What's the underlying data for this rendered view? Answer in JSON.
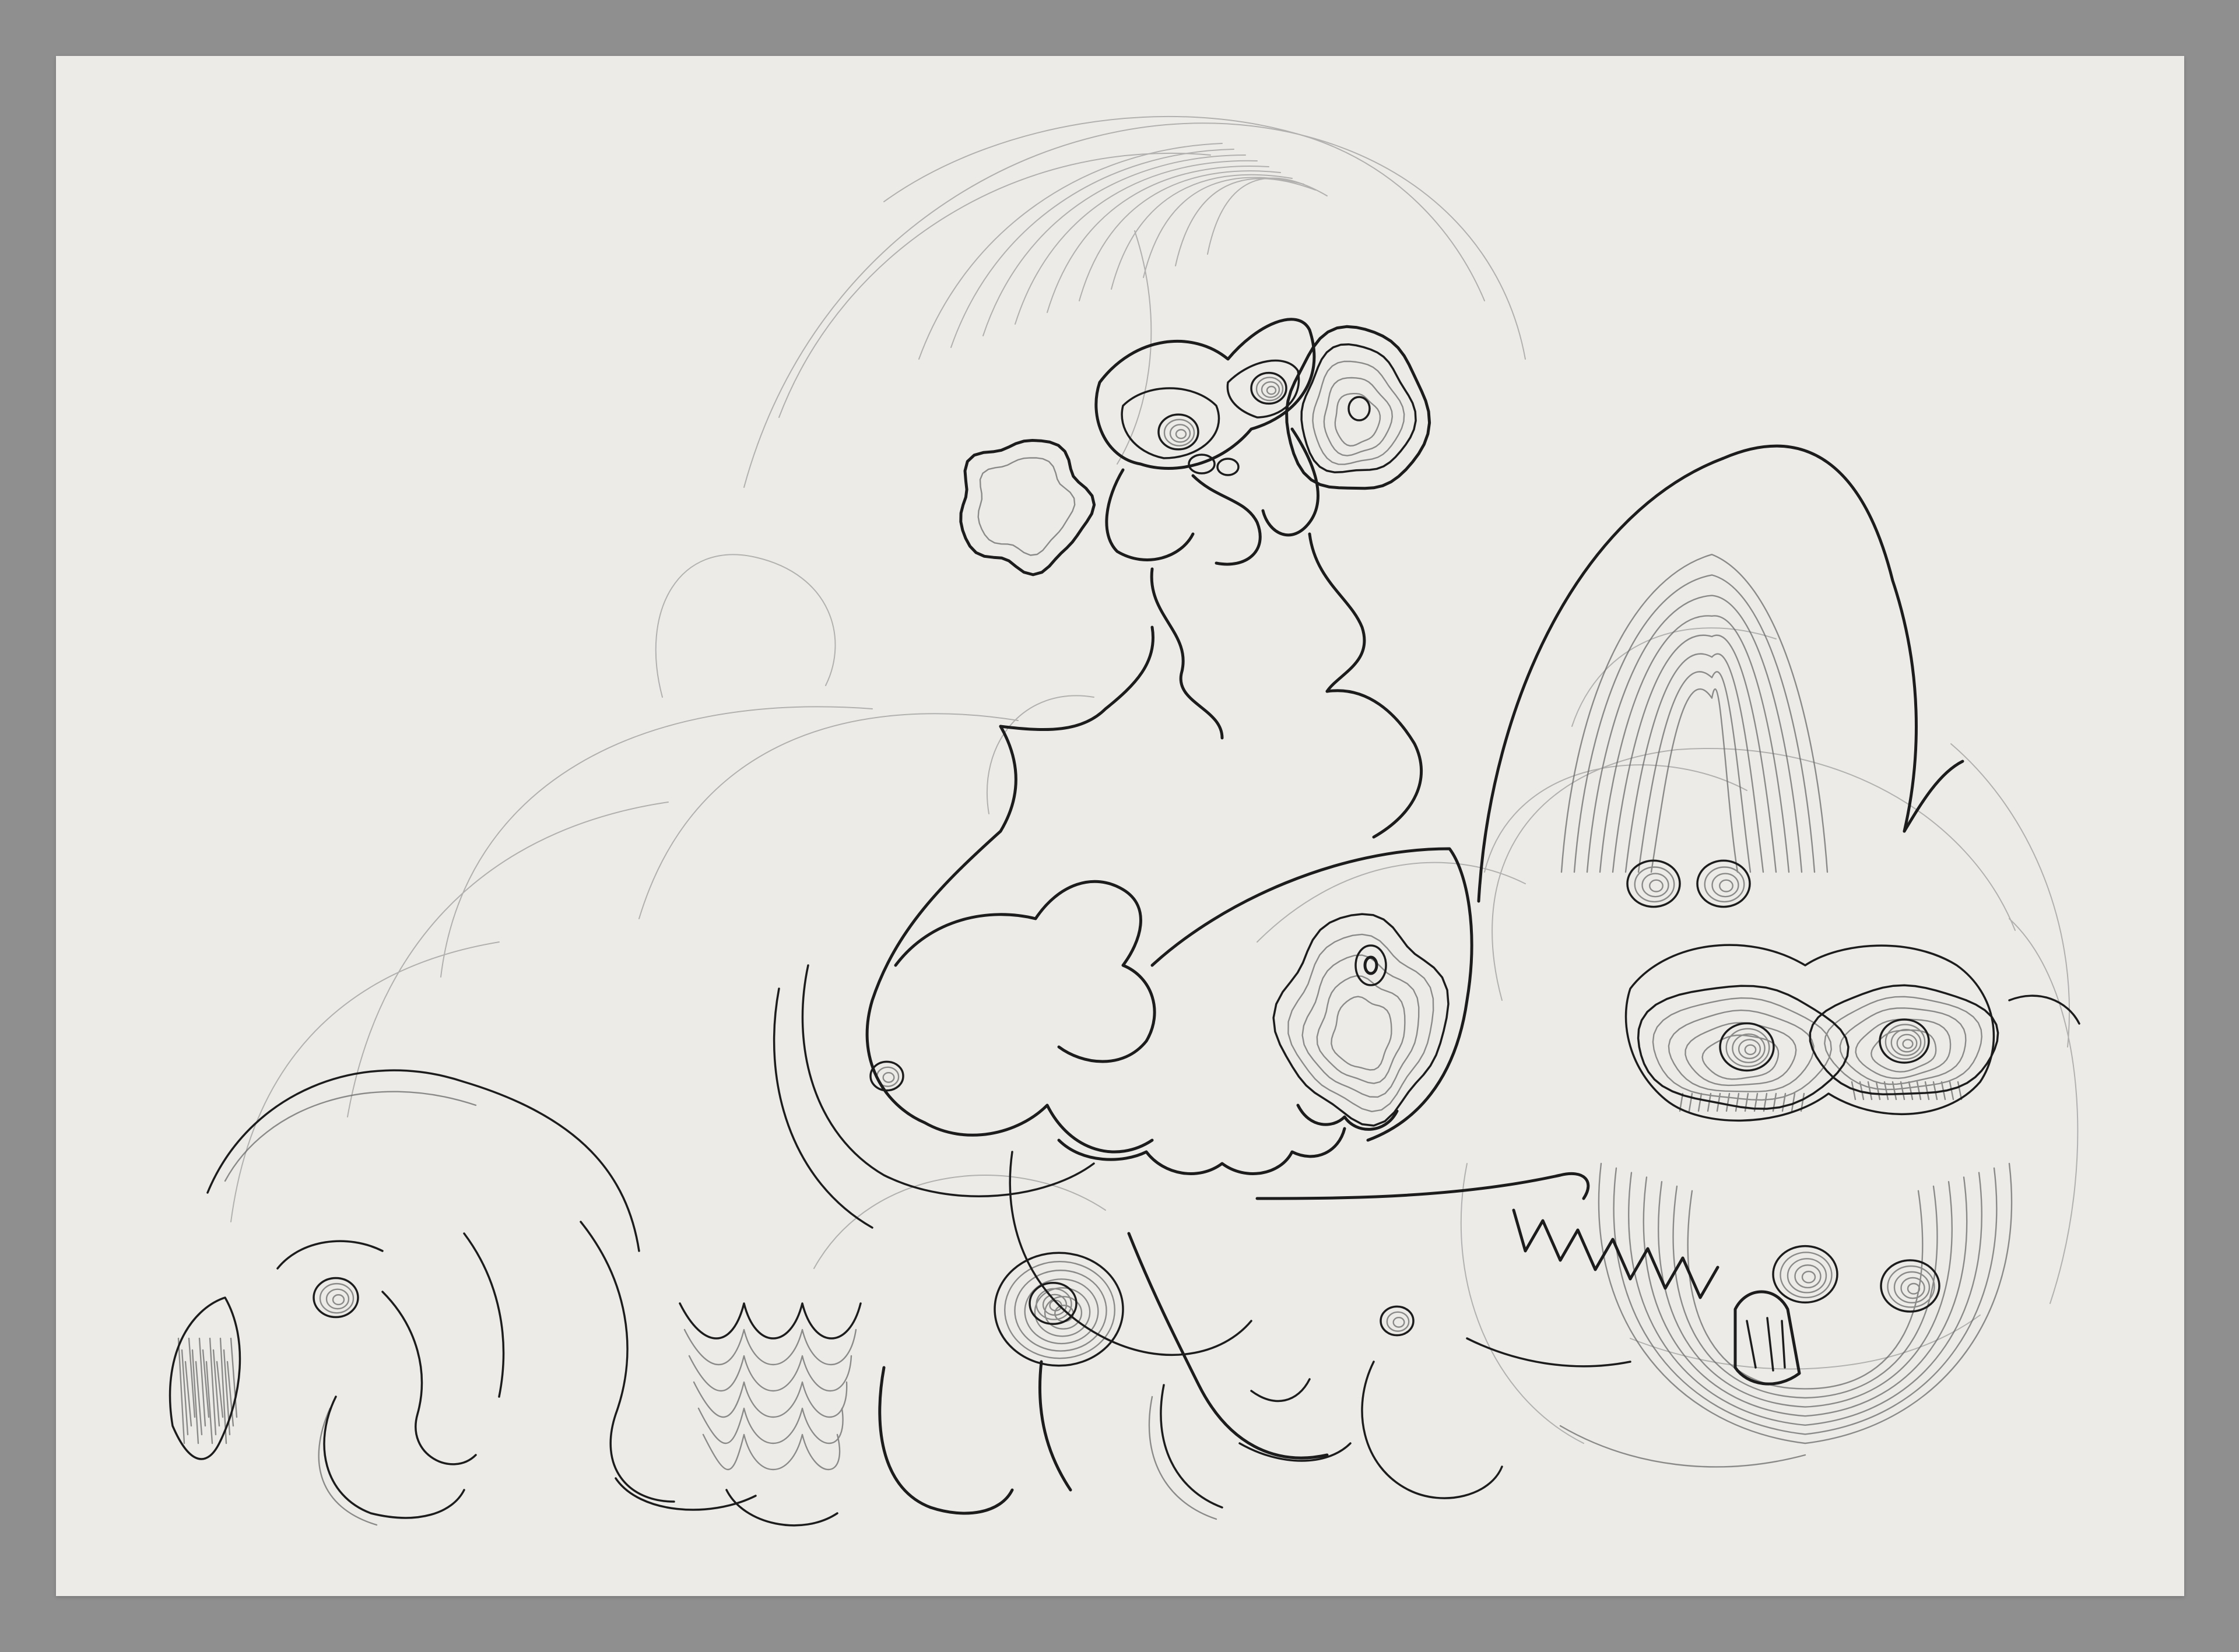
{
  "artwork": {
    "background_color": "#8f8f8f",
    "paper_color": "#ecebe8",
    "ink_color": "#1c1c1c",
    "faint_ink_color": "#6a6a6a"
  }
}
